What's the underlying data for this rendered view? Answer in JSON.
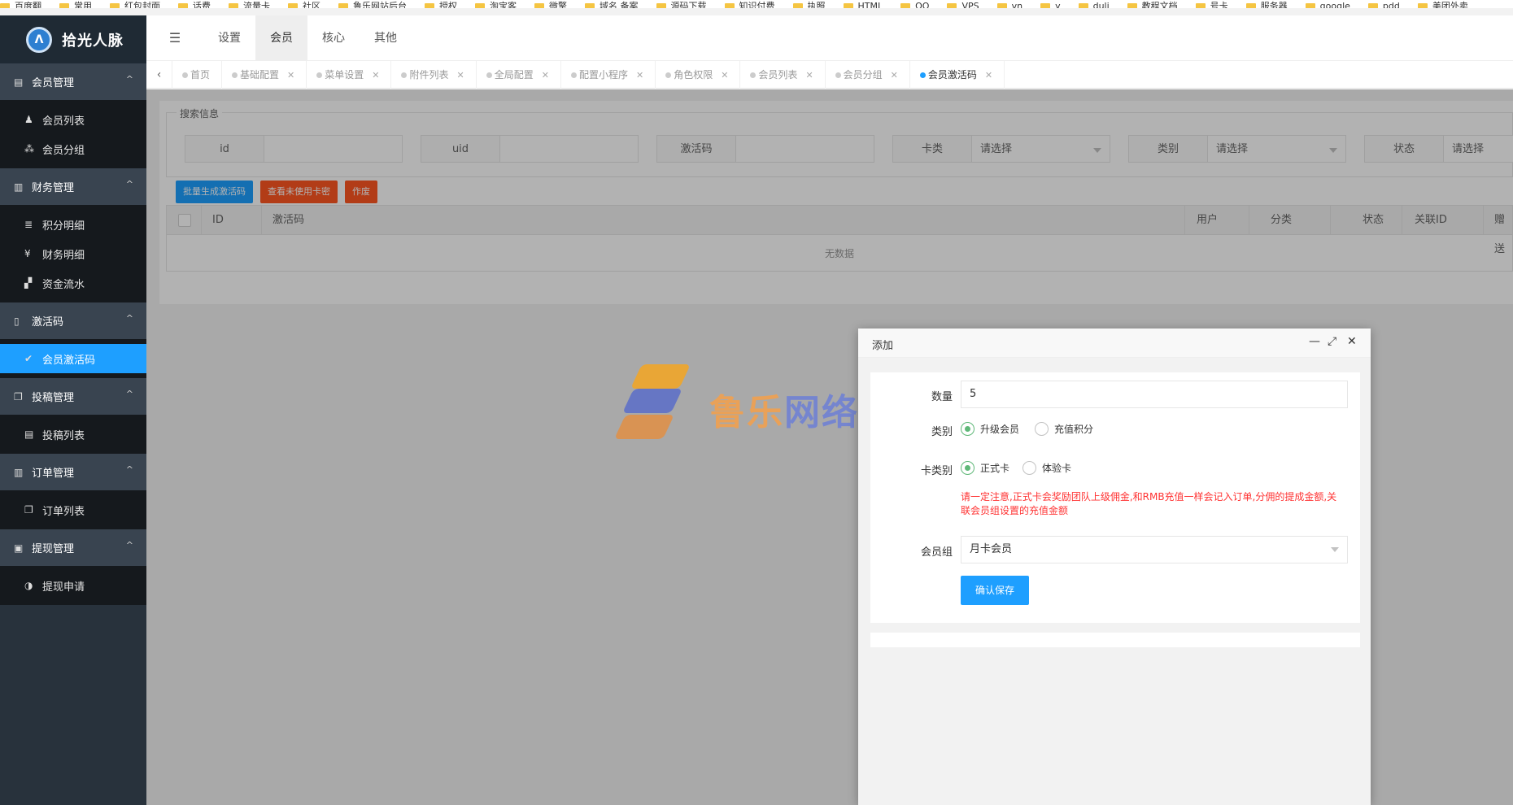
{
  "bookmarks": [
    "百度翻",
    "常用",
    "红包封面",
    "话费",
    "流量卡",
    "社区",
    "鲁乐网站后台",
    "授权",
    "淘宝客",
    "微擎",
    "域名 备案",
    "源码下载",
    "知识付费",
    "执照",
    "HTML",
    "QQ",
    "VPS",
    "vn",
    "y",
    "duli",
    "教程文档",
    "号卡",
    "服务器",
    "google",
    "pdd",
    "美团外卖"
  ],
  "app": {
    "title": "拾光人脉",
    "logo_letter": "Λ"
  },
  "sidebar": {
    "groups": [
      {
        "label": "会员管理",
        "icon": "id-card-icon",
        "glyph": "▤",
        "items": [
          {
            "label": "会员列表",
            "icon": "user-icon",
            "glyph": "♟"
          },
          {
            "label": "会员分组",
            "icon": "users-icon",
            "glyph": "⁂"
          }
        ]
      },
      {
        "label": "财务管理",
        "icon": "file-icon",
        "glyph": "▥",
        "items": [
          {
            "label": "积分明细",
            "icon": "database-icon",
            "glyph": "≣"
          },
          {
            "label": "财务明细",
            "icon": "yen-icon",
            "glyph": "¥"
          },
          {
            "label": "资金流水",
            "icon": "qrcode-icon",
            "glyph": "▞"
          }
        ]
      },
      {
        "label": "激活码",
        "icon": "tablet-icon",
        "glyph": "▯",
        "items": [
          {
            "label": "会员激活码",
            "icon": "check-icon",
            "glyph": "✔",
            "active": true
          }
        ]
      },
      {
        "label": "投稿管理",
        "icon": "clone-icon",
        "glyph": "❐",
        "items": [
          {
            "label": "投稿列表",
            "icon": "list-icon",
            "glyph": "▤"
          }
        ]
      },
      {
        "label": "订单管理",
        "icon": "file-icon",
        "glyph": "▥",
        "items": [
          {
            "label": "订单列表",
            "icon": "clone-icon",
            "glyph": "❐"
          }
        ]
      },
      {
        "label": "提现管理",
        "icon": "money-icon",
        "glyph": "▣",
        "items": [
          {
            "label": "提现申请",
            "icon": "adjust-icon",
            "glyph": "◑"
          }
        ]
      }
    ]
  },
  "topnav": {
    "toggle_glyph": "☰",
    "items": [
      "设置",
      "会员",
      "核心",
      "其他"
    ],
    "active": "会员"
  },
  "tabs": {
    "prev_glyph": "‹",
    "items": [
      "首页",
      "基础配置",
      "菜单设置",
      "附件列表",
      "全局配置",
      "配置小程序",
      "角色权限",
      "会员列表",
      "会员分组",
      "会员激活码"
    ],
    "active": "会员激活码"
  },
  "search": {
    "legend": "搜索信息",
    "fields": [
      {
        "label": "id",
        "value": ""
      },
      {
        "label": "uid",
        "value": ""
      },
      {
        "label": "激活码",
        "value": ""
      },
      {
        "label": "卡类",
        "value": "请选择"
      },
      {
        "label": "类别",
        "value": "请选择"
      },
      {
        "label": "状态",
        "value": "请选择"
      }
    ]
  },
  "toolbar": {
    "generate": "批量生成激活码",
    "view_unused": "查看未使用卡密",
    "void": "作废"
  },
  "table": {
    "columns": [
      "ID",
      "激活码",
      "用户",
      "分类",
      "状态",
      "关联ID",
      "赠送"
    ],
    "empty": "无数据"
  },
  "watermark": {
    "text1": "鲁乐",
    "text2": "网络"
  },
  "modal": {
    "title": "添加",
    "controls": {
      "minimize": "—",
      "maximize": "⤢",
      "close": "✕"
    },
    "quantity_label": "数量",
    "quantity_value": "5",
    "type_label": "类别",
    "type_options": [
      "升级会员",
      "充值积分"
    ],
    "type_selected": "升级会员",
    "card_label": "卡类别",
    "card_options": [
      "正式卡",
      "体验卡"
    ],
    "card_selected": "正式卡",
    "warning": "请一定注意,正式卡会奖励团队上级佣金,和RMB充值一样会记入订单,分佣的提成金额,关联会员组设置的充值金额",
    "group_label": "会员组",
    "group_value": "月卡会员",
    "save_label": "确认保存"
  },
  "colors": {
    "accent": "#1e9fff",
    "danger": "#ff5722",
    "sidebar": "#28323c",
    "radio_on": "#5fb878",
    "warning": "#ff3333"
  }
}
